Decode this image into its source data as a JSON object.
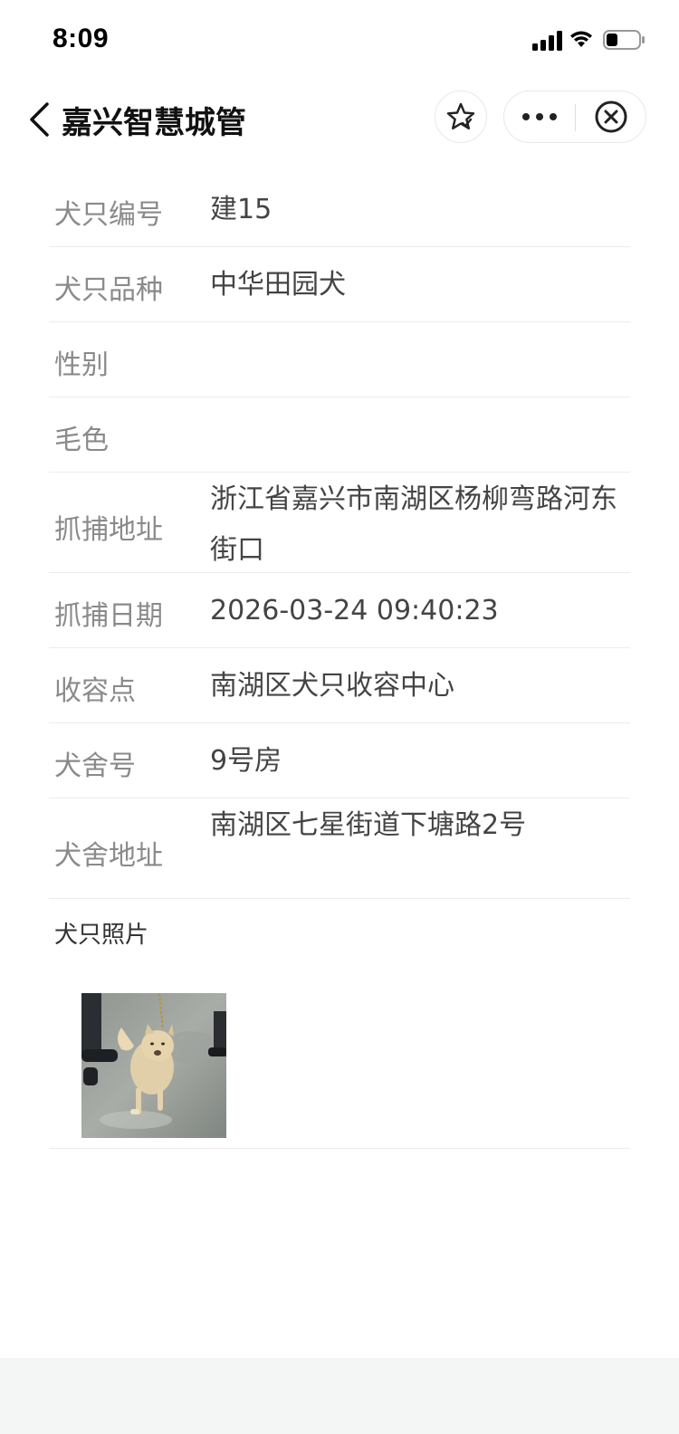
{
  "status_bar": {
    "time": "8:09",
    "icons": [
      "signal-icon",
      "wifi-icon",
      "battery-icon"
    ]
  },
  "nav": {
    "title": "嘉兴智慧城管",
    "icons": [
      "back-icon",
      "star-icon",
      "more-icon",
      "close-circle-icon"
    ]
  },
  "rows": [
    {
      "label": "犬只编号",
      "value": "建15"
    },
    {
      "label": "犬只品种",
      "value": "中华田园犬"
    },
    {
      "label": "性别",
      "value": ""
    },
    {
      "label": "毛色",
      "value": ""
    },
    {
      "label": "抓捕地址",
      "value": "浙江省嘉兴市南湖区杨柳弯路河东街口"
    },
    {
      "label": "抓捕日期",
      "value": "2026-03-24 09:40:23"
    },
    {
      "label": "收容点",
      "value": "南湖区犬只收容中心"
    },
    {
      "label": "犬舍号",
      "value": "9号房"
    },
    {
      "label": "犬舍地址",
      "value": "南湖区七星街道下塘路2号"
    }
  ],
  "photo_section": {
    "title": "犬只照片"
  }
}
